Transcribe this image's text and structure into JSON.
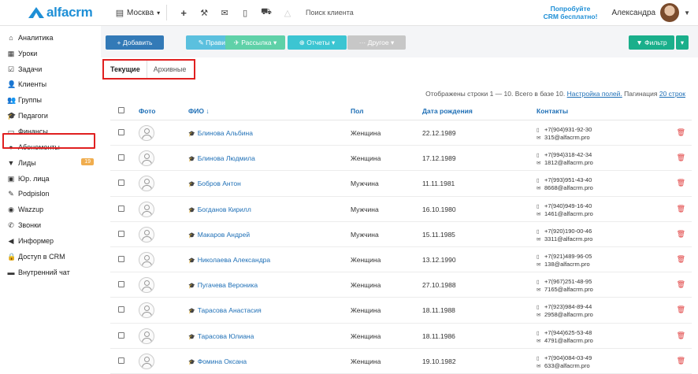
{
  "topbar": {
    "logo": "alfacrm",
    "city": "Москва",
    "city_icon": "building-icon",
    "search_placeholder": "Поиск клиента",
    "promo_line1": "Попробуйте",
    "promo_line2": "CRM бесплатно!",
    "user_name": "Александра",
    "icons": [
      "plus-icon",
      "wrench-icon",
      "mail-icon",
      "mobile-icon",
      "cart-icon",
      "warning-icon"
    ]
  },
  "sidebar": {
    "items": [
      {
        "label": "Аналитика",
        "icon": "bank-icon",
        "glyph": "⌂"
      },
      {
        "label": "Уроки",
        "icon": "calendar-icon",
        "glyph": "▦"
      },
      {
        "label": "Задачи",
        "icon": "tasks-icon",
        "glyph": "☑"
      },
      {
        "label": "Клиенты",
        "icon": "user-icon",
        "glyph": "👤"
      },
      {
        "label": "Группы",
        "icon": "users-icon",
        "glyph": "👥"
      },
      {
        "label": "Педагоги",
        "icon": "graduation-cap-icon",
        "glyph": "🎓"
      },
      {
        "label": "Финансы",
        "icon": "money-icon",
        "glyph": "▭"
      },
      {
        "label": "Абонементы",
        "icon": "ticket-icon",
        "glyph": "●"
      },
      {
        "label": "Лиды",
        "icon": "filter-icon",
        "glyph": "▼",
        "badge": "19"
      },
      {
        "label": "Юр. лица",
        "icon": "suitcase-icon",
        "glyph": "▣"
      },
      {
        "label": "Podpislon",
        "icon": "signature-icon",
        "glyph": "✎"
      },
      {
        "label": "Wazzup",
        "icon": "whatsapp-icon",
        "glyph": "◉"
      },
      {
        "label": "Звонки",
        "icon": "phone-icon",
        "glyph": "✆"
      },
      {
        "label": "Информер",
        "icon": "bullhorn-icon",
        "glyph": "◀"
      },
      {
        "label": "Доступ в CRM",
        "icon": "lock-icon",
        "glyph": "🔒"
      },
      {
        "label": "Внутренний чат",
        "icon": "chat-icon",
        "glyph": "▬"
      }
    ]
  },
  "toolbar": {
    "add": "+ Добавить",
    "edit": "✎ Править",
    "mailing": "✈ Рассылка ▾",
    "reports": "⊕ Отчеты ▾",
    "other": "··· Другое ▾",
    "filter": "▼ Фильтр",
    "filter_caret": "▾",
    "colors": {
      "add": "#337ab7",
      "edit": "#5bc0de",
      "mailing": "#5fd1a8",
      "reports": "#3cc5d2",
      "other": "#c7c7c7",
      "filter": "#1aaf8b"
    }
  },
  "tabs": {
    "current": "Текущие",
    "archive": "Архивные"
  },
  "info": {
    "text": "Отображены строки 1 — 10. Всего в базе 10.",
    "settings_link": "Настройка полей.",
    "pagination_label": "Пагинация",
    "pagination_link": "20 строк"
  },
  "table": {
    "headers": {
      "photo": "Фото",
      "name": "ФИО ↓",
      "gender": "Пол",
      "birth": "Дата рождения",
      "contacts": "Контакты"
    },
    "rows": [
      {
        "name": "Блинова Альбина",
        "gender": "Женщина",
        "birth": "22.12.1989",
        "phone": "+7(904)931-92-30",
        "email": "315@alfacrm.pro"
      },
      {
        "name": "Блинова Людмила",
        "gender": "Женщина",
        "birth": "17.12.1989",
        "phone": "+7(994)318-42-34",
        "email": "1812@alfacrm.pro"
      },
      {
        "name": "Бобров Антон",
        "gender": "Мужчина",
        "birth": "11.11.1981",
        "phone": "+7(993)951-43-40",
        "email": "8668@alfacrm.pro"
      },
      {
        "name": "Богданов Кирилл",
        "gender": "Мужчина",
        "birth": "16.10.1980",
        "phone": "+7(940)949-16-40",
        "email": "1461@alfacrm.pro"
      },
      {
        "name": "Макаров Андрей",
        "gender": "Мужчина",
        "birth": "15.11.1985",
        "phone": "+7(920)190-00-46",
        "email": "3311@alfacrm.pro"
      },
      {
        "name": "Николаева Александра",
        "gender": "Женщина",
        "birth": "13.12.1990",
        "phone": "+7(921)489-96-05",
        "email": "138@alfacrm.pro"
      },
      {
        "name": "Пугачева Вероника",
        "gender": "Женщина",
        "birth": "27.10.1988",
        "phone": "+7(967)251-48-95",
        "email": "7165@alfacrm.pro"
      },
      {
        "name": "Тарасова Анастасия",
        "gender": "Женщина",
        "birth": "18.11.1988",
        "phone": "+7(923)984-89-44",
        "email": "2958@alfacrm.pro"
      },
      {
        "name": "Тарасова Юлиана",
        "gender": "Женщина",
        "birth": "18.11.1986",
        "phone": "+7(944)625-53-48",
        "email": "4791@alfacrm.pro"
      },
      {
        "name": "Фомина Оксана",
        "gender": "Женщина",
        "birth": "19.10.1982",
        "phone": "+7(904)084-03-49",
        "email": "633@alfacrm.pro"
      }
    ]
  }
}
